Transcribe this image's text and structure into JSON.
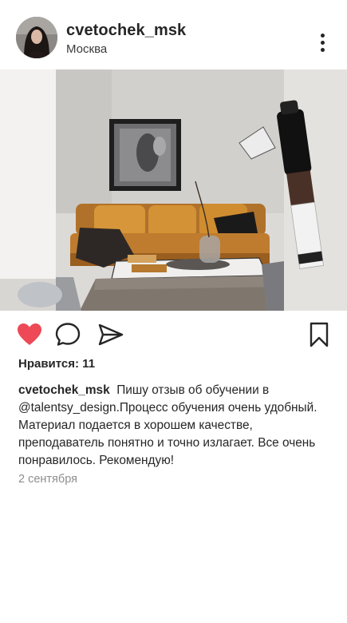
{
  "post": {
    "username": "cvetochek_msk",
    "location": "Москва",
    "likes_text": "Нравится: 11",
    "caption_user": "cvetochek_msk",
    "caption_text": "Пишу отзыв об обучении в @talentsy_design.Процесс обучения очень удобный. Материал подается в хорошем качестве, преподаватель понятно и точно излагает. Все очень понравилось. Рекомендую!",
    "date": "2 сентября",
    "liked": true
  },
  "icons": {
    "more": "more-vertical-icon",
    "like": "heart-icon",
    "comment": "comment-icon",
    "share": "send-icon",
    "save": "bookmark-icon"
  },
  "colors": {
    "like_active": "#ed4956",
    "text": "#262626",
    "muted": "#8e8e8e"
  }
}
